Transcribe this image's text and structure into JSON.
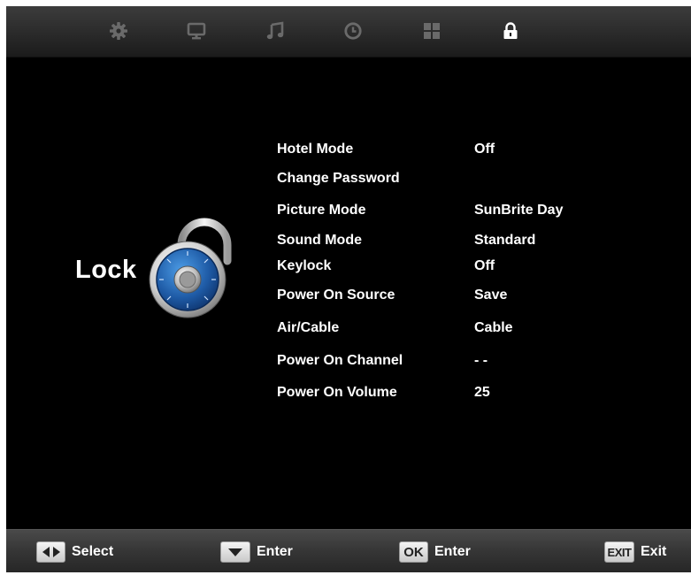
{
  "tabs": [
    {
      "icon": "gear-icon"
    },
    {
      "icon": "monitor-icon"
    },
    {
      "icon": "music-note-icon"
    },
    {
      "icon": "clock-icon"
    },
    {
      "icon": "grid-icon"
    },
    {
      "icon": "lock-icon",
      "active": true
    }
  ],
  "page": {
    "title": "Lock",
    "icon": "padlock-icon"
  },
  "menu": [
    {
      "label": "Hotel Mode",
      "value": "Off"
    },
    {
      "label": "Change Password",
      "value": ""
    },
    {
      "label": "Picture Mode",
      "value": "SunBrite Day"
    },
    {
      "label": "Sound Mode",
      "value": "Standard"
    },
    {
      "label": "Keylock",
      "value": "Off"
    },
    {
      "label": "Power On Source",
      "value": "Save"
    },
    {
      "label": "Air/Cable",
      "value": "Cable"
    },
    {
      "label": "Power On Channel",
      "value": "- -"
    },
    {
      "label": "Power On Volume",
      "value": "25"
    }
  ],
  "footer": {
    "select": {
      "key": "",
      "label": "Select"
    },
    "enter1": {
      "key": "",
      "label": "Enter"
    },
    "enter2": {
      "key": "OK",
      "label": "Enter"
    },
    "exit": {
      "key": "EXIT",
      "label": "Exit"
    }
  },
  "colors": {
    "background": "#000000",
    "text": "#ffffff",
    "dial": "#1f5fa8",
    "inactive_icon": "#6a6a6a"
  }
}
